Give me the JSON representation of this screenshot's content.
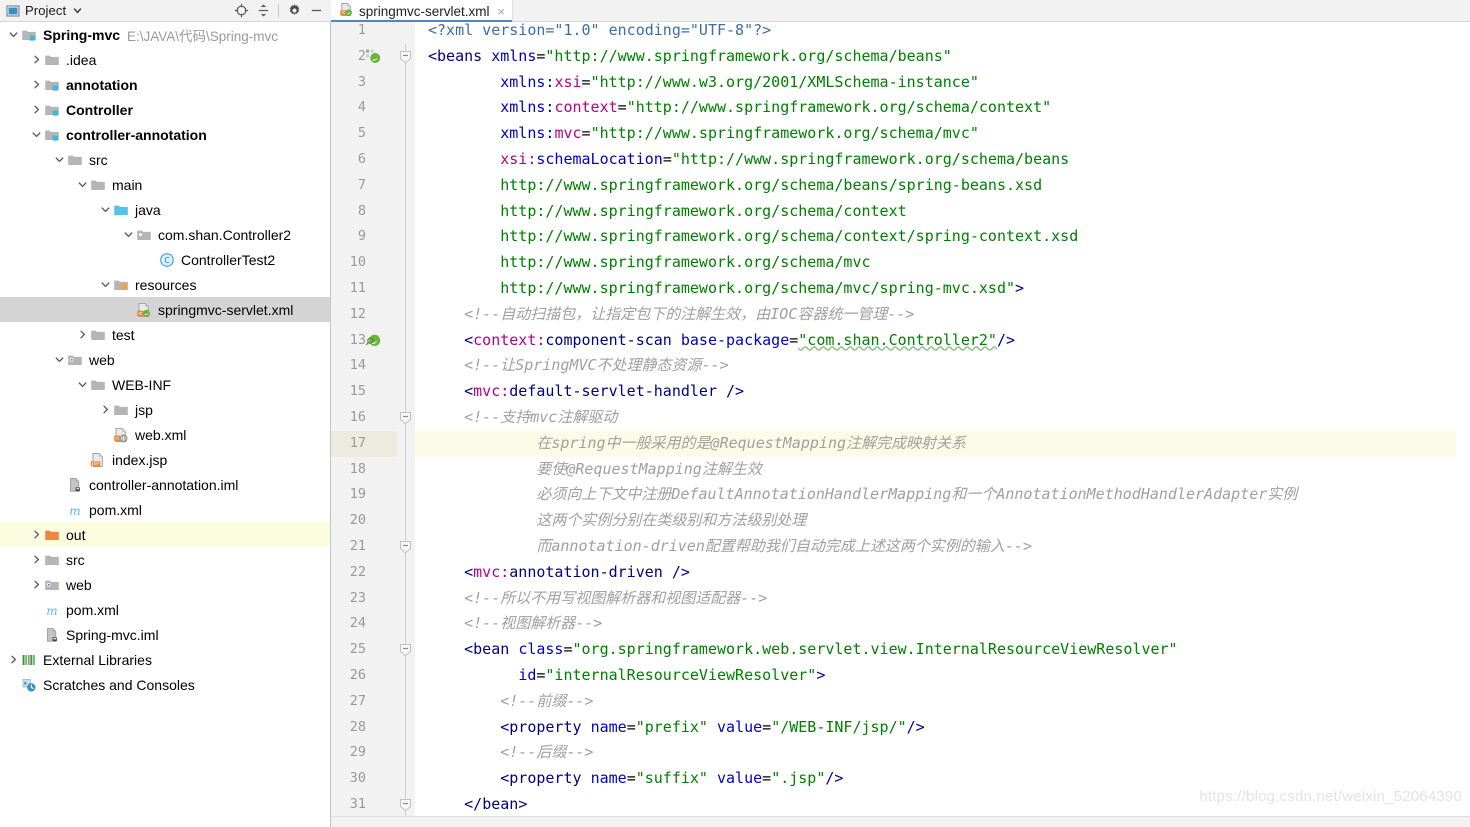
{
  "tool_window": {
    "title": "Project",
    "icons": [
      "project-view-icon",
      "chevron-down-icon",
      "locate-target-icon",
      "collapse-all-icon",
      "settings-gear-icon",
      "hide-window-icon"
    ]
  },
  "editor_tabs": [
    {
      "label": "springmvc-servlet.xml",
      "icon": "xml-spring-file-icon",
      "close": "×",
      "active": true
    }
  ],
  "project_tree": [
    {
      "indent": 0,
      "arrow": "down",
      "icon": "module-folder-icon",
      "label": "Spring-mvc",
      "bold": true,
      "path": "E:\\JAVA\\代码\\Spring-mvc",
      "state": "normal"
    },
    {
      "indent": 1,
      "arrow": "right",
      "icon": "folder-icon",
      "label": ".idea",
      "bold": false,
      "path": "",
      "state": "normal"
    },
    {
      "indent": 1,
      "arrow": "right",
      "icon": "module-folder-icon",
      "label": "annotation",
      "bold": true,
      "path": "",
      "state": "normal"
    },
    {
      "indent": 1,
      "arrow": "right",
      "icon": "module-folder-icon",
      "label": "Controller",
      "bold": true,
      "path": "",
      "state": "normal"
    },
    {
      "indent": 1,
      "arrow": "down",
      "icon": "module-folder-icon",
      "label": "controller-annotation",
      "bold": true,
      "path": "",
      "state": "normal"
    },
    {
      "indent": 2,
      "arrow": "down",
      "icon": "folder-icon",
      "label": "src",
      "bold": false,
      "path": "",
      "state": "normal"
    },
    {
      "indent": 3,
      "arrow": "down",
      "icon": "folder-icon",
      "label": "main",
      "bold": false,
      "path": "",
      "state": "normal"
    },
    {
      "indent": 4,
      "arrow": "down",
      "icon": "source-root-icon",
      "label": "java",
      "bold": false,
      "path": "",
      "state": "normal"
    },
    {
      "indent": 5,
      "arrow": "down",
      "icon": "package-icon",
      "label": "com.shan.Controller2",
      "bold": false,
      "path": "",
      "state": "normal"
    },
    {
      "indent": 6,
      "arrow": "none",
      "icon": "java-class-icon",
      "label": "ControllerTest2",
      "bold": false,
      "path": "",
      "state": "normal"
    },
    {
      "indent": 4,
      "arrow": "down",
      "icon": "resource-root-icon",
      "label": "resources",
      "bold": false,
      "path": "",
      "state": "normal"
    },
    {
      "indent": 5,
      "arrow": "none",
      "icon": "xml-spring-file-icon",
      "label": "springmvc-servlet.xml",
      "bold": false,
      "path": "",
      "state": "selected"
    },
    {
      "indent": 3,
      "arrow": "right",
      "icon": "folder-icon",
      "label": "test",
      "bold": false,
      "path": "",
      "state": "normal"
    },
    {
      "indent": 2,
      "arrow": "down",
      "icon": "web-root-icon",
      "label": "web",
      "bold": false,
      "path": "",
      "state": "normal"
    },
    {
      "indent": 3,
      "arrow": "down",
      "icon": "folder-icon",
      "label": "WEB-INF",
      "bold": false,
      "path": "",
      "state": "normal"
    },
    {
      "indent": 4,
      "arrow": "right",
      "icon": "folder-icon",
      "label": "jsp",
      "bold": false,
      "path": "",
      "state": "normal"
    },
    {
      "indent": 4,
      "arrow": "none",
      "icon": "xml-web-file-icon",
      "label": "web.xml",
      "bold": false,
      "path": "",
      "state": "normal"
    },
    {
      "indent": 3,
      "arrow": "none",
      "icon": "jsp-file-icon",
      "label": "index.jsp",
      "bold": false,
      "path": "",
      "state": "normal"
    },
    {
      "indent": 2,
      "arrow": "none",
      "icon": "iml-file-icon",
      "label": "controller-annotation.iml",
      "bold": false,
      "path": "",
      "state": "normal"
    },
    {
      "indent": 2,
      "arrow": "none",
      "icon": "maven-pom-icon",
      "label": "pom.xml",
      "bold": false,
      "path": "",
      "state": "normal"
    },
    {
      "indent": 1,
      "arrow": "right",
      "icon": "excluded-folder-icon",
      "label": "out",
      "bold": false,
      "path": "",
      "state": "highlight"
    },
    {
      "indent": 1,
      "arrow": "right",
      "icon": "folder-icon",
      "label": "src",
      "bold": false,
      "path": "",
      "state": "normal"
    },
    {
      "indent": 1,
      "arrow": "right",
      "icon": "web-root-icon",
      "label": "web",
      "bold": false,
      "path": "",
      "state": "normal"
    },
    {
      "indent": 1,
      "arrow": "none",
      "icon": "maven-pom-icon",
      "label": "pom.xml",
      "bold": false,
      "path": "",
      "state": "normal"
    },
    {
      "indent": 1,
      "arrow": "none",
      "icon": "iml-file-icon",
      "label": "Spring-mvc.iml",
      "bold": false,
      "path": "",
      "state": "normal"
    },
    {
      "indent": 0,
      "arrow": "right",
      "icon": "external-libraries-icon",
      "label": "External Libraries",
      "bold": false,
      "path": "",
      "state": "normal"
    },
    {
      "indent": 0,
      "arrow": "none",
      "icon": "scratches-icon",
      "label": "Scratches and Consoles",
      "bold": false,
      "path": "",
      "state": "normal"
    }
  ],
  "editor": {
    "file_name": "springmvc-servlet.xml",
    "current_line": 17,
    "first_visible_line": 1,
    "last_visible_line": 31,
    "gutter_icons": [
      {
        "line": 2,
        "icon": "spring-bean-gutter-icon"
      },
      {
        "line": 13,
        "icon": "spring-scan-gutter-icon"
      }
    ],
    "fold_markers": [
      2,
      16,
      21,
      25,
      31
    ],
    "lines": [
      {
        "n": 1,
        "indent": 0,
        "tokens": [
          {
            "c": "t-pi",
            "t": "<?xml version=\"1.0\" encoding=\"UTF-8\"?>"
          }
        ]
      },
      {
        "n": 2,
        "indent": 0,
        "tokens": [
          {
            "c": "t-br",
            "t": "<"
          },
          {
            "c": "t-tag",
            "t": "beans"
          },
          {
            "c": "t-eq",
            "t": " "
          },
          {
            "c": "t-attr",
            "t": "xmlns"
          },
          {
            "c": "t-eq",
            "t": "="
          },
          {
            "c": "t-str",
            "t": "\"http://www.springframework.org/schema/beans\""
          }
        ]
      },
      {
        "n": 3,
        "indent": 8,
        "tokens": [
          {
            "c": "t-attr",
            "t": "xmlns:"
          },
          {
            "c": "t-ns",
            "t": "xsi"
          },
          {
            "c": "t-eq",
            "t": "="
          },
          {
            "c": "t-str",
            "t": "\"http://www.w3.org/2001/XMLSchema-instance\""
          }
        ]
      },
      {
        "n": 4,
        "indent": 8,
        "tokens": [
          {
            "c": "t-attr",
            "t": "xmlns:"
          },
          {
            "c": "t-ns",
            "t": "context"
          },
          {
            "c": "t-eq",
            "t": "="
          },
          {
            "c": "t-str",
            "t": "\"http://www.springframework.org/schema/context\""
          }
        ]
      },
      {
        "n": 5,
        "indent": 8,
        "tokens": [
          {
            "c": "t-attr",
            "t": "xmlns:"
          },
          {
            "c": "t-ns",
            "t": "mvc"
          },
          {
            "c": "t-eq",
            "t": "="
          },
          {
            "c": "t-str",
            "t": "\"http://www.springframework.org/schema/mvc\""
          }
        ]
      },
      {
        "n": 6,
        "indent": 8,
        "tokens": [
          {
            "c": "t-ns",
            "t": "xsi:"
          },
          {
            "c": "t-attr",
            "t": "schemaLocation"
          },
          {
            "c": "t-eq",
            "t": "="
          },
          {
            "c": "t-str",
            "t": "\"http://www.springframework.org/schema/beans"
          }
        ]
      },
      {
        "n": 7,
        "indent": 8,
        "tokens": [
          {
            "c": "t-str",
            "t": "http://www.springframework.org/schema/beans/spring-beans.xsd"
          }
        ]
      },
      {
        "n": 8,
        "indent": 8,
        "tokens": [
          {
            "c": "t-str",
            "t": "http://www.springframework.org/schema/context"
          }
        ]
      },
      {
        "n": 9,
        "indent": 8,
        "tokens": [
          {
            "c": "t-str",
            "t": "http://www.springframework.org/schema/context/spring-context.xsd"
          }
        ]
      },
      {
        "n": 10,
        "indent": 8,
        "tokens": [
          {
            "c": "t-str",
            "t": "http://www.springframework.org/schema/mvc"
          }
        ]
      },
      {
        "n": 11,
        "indent": 8,
        "tokens": [
          {
            "c": "t-str",
            "t": "http://www.springframework.org/schema/mvc/spring-mvc.xsd\""
          },
          {
            "c": "t-br",
            "t": ">"
          }
        ]
      },
      {
        "n": 12,
        "indent": 4,
        "tokens": [
          {
            "c": "t-cmt",
            "t": "<!--自动扫描包，让指定包下的注解生效，由IOC容器统一管理-->"
          }
        ]
      },
      {
        "n": 13,
        "indent": 4,
        "tokens": [
          {
            "c": "t-br",
            "t": "<"
          },
          {
            "c": "t-ns",
            "t": "context:"
          },
          {
            "c": "t-tag",
            "t": "component-scan"
          },
          {
            "c": "t-eq",
            "t": " "
          },
          {
            "c": "t-attr",
            "t": "base-package"
          },
          {
            "c": "t-eq",
            "t": "="
          },
          {
            "c": "t-str squig",
            "t": "\"com.shan.Controller2\""
          },
          {
            "c": "t-br",
            "t": "/>"
          }
        ]
      },
      {
        "n": 14,
        "indent": 4,
        "tokens": [
          {
            "c": "t-cmt",
            "t": "<!--让SpringMVC不处理静态资源-->"
          }
        ]
      },
      {
        "n": 15,
        "indent": 4,
        "tokens": [
          {
            "c": "t-br",
            "t": "<"
          },
          {
            "c": "t-ns",
            "t": "mvc:"
          },
          {
            "c": "t-tag",
            "t": "default-servlet-handler"
          },
          {
            "c": "t-eq",
            "t": " "
          },
          {
            "c": "t-br",
            "t": "/>"
          }
        ]
      },
      {
        "n": 16,
        "indent": 4,
        "tokens": [
          {
            "c": "t-cmt",
            "t": "<!--支持mvc注解驱动"
          }
        ]
      },
      {
        "n": 17,
        "indent": 12,
        "tokens": [
          {
            "c": "t-cmt",
            "t": "在spring中一般采用的是@RequestMapping注解完成映射关系"
          }
        ]
      },
      {
        "n": 18,
        "indent": 12,
        "tokens": [
          {
            "c": "t-cmt",
            "t": "要使@RequestMapping注解生效"
          }
        ]
      },
      {
        "n": 19,
        "indent": 12,
        "tokens": [
          {
            "c": "t-cmt",
            "t": "必须向上下文中注册DefaultAnnotationHandlerMapping和一个AnnotationMethodHandlerAdapter实例"
          }
        ]
      },
      {
        "n": 20,
        "indent": 12,
        "tokens": [
          {
            "c": "t-cmt",
            "t": "这两个实例分别在类级别和方法级别处理"
          }
        ]
      },
      {
        "n": 21,
        "indent": 12,
        "tokens": [
          {
            "c": "t-cmt",
            "t": "而annotation-driven配置帮助我们自动完成上述这两个实例的输入-->"
          }
        ]
      },
      {
        "n": 22,
        "indent": 4,
        "tokens": [
          {
            "c": "t-br",
            "t": "<"
          },
          {
            "c": "t-ns",
            "t": "mvc:"
          },
          {
            "c": "t-tag",
            "t": "annotation-driven"
          },
          {
            "c": "t-eq",
            "t": " "
          },
          {
            "c": "t-br",
            "t": "/>"
          }
        ]
      },
      {
        "n": 23,
        "indent": 4,
        "tokens": [
          {
            "c": "t-cmt",
            "t": "<!--所以不用写视图解析器和视图适配器-->"
          }
        ]
      },
      {
        "n": 24,
        "indent": 4,
        "tokens": [
          {
            "c": "t-cmt",
            "t": "<!--视图解析器-->"
          }
        ]
      },
      {
        "n": 25,
        "indent": 4,
        "tokens": [
          {
            "c": "t-br",
            "t": "<"
          },
          {
            "c": "t-tag",
            "t": "bean"
          },
          {
            "c": "t-eq",
            "t": " "
          },
          {
            "c": "t-attr",
            "t": "class"
          },
          {
            "c": "t-eq",
            "t": "="
          },
          {
            "c": "t-str",
            "t": "\"org.springframework.web.servlet.view.InternalResourceViewResolver\""
          }
        ]
      },
      {
        "n": 26,
        "indent": 10,
        "tokens": [
          {
            "c": "t-attr",
            "t": "id"
          },
          {
            "c": "t-eq",
            "t": "="
          },
          {
            "c": "t-str",
            "t": "\"internalResourceViewResolver\""
          },
          {
            "c": "t-br",
            "t": ">"
          }
        ]
      },
      {
        "n": 27,
        "indent": 8,
        "tokens": [
          {
            "c": "t-cmt",
            "t": "<!--前缀-->"
          }
        ]
      },
      {
        "n": 28,
        "indent": 8,
        "tokens": [
          {
            "c": "t-br",
            "t": "<"
          },
          {
            "c": "t-tag",
            "t": "property"
          },
          {
            "c": "t-eq",
            "t": " "
          },
          {
            "c": "t-attr",
            "t": "name"
          },
          {
            "c": "t-eq",
            "t": "="
          },
          {
            "c": "t-str",
            "t": "\"prefix\""
          },
          {
            "c": "t-eq",
            "t": " "
          },
          {
            "c": "t-attr",
            "t": "value"
          },
          {
            "c": "t-eq",
            "t": "="
          },
          {
            "c": "t-str",
            "t": "\"/WEB-INF/jsp/\""
          },
          {
            "c": "t-br",
            "t": "/>"
          }
        ]
      },
      {
        "n": 29,
        "indent": 8,
        "tokens": [
          {
            "c": "t-cmt",
            "t": "<!--后缀-->"
          }
        ]
      },
      {
        "n": 30,
        "indent": 8,
        "tokens": [
          {
            "c": "t-br",
            "t": "<"
          },
          {
            "c": "t-tag",
            "t": "property"
          },
          {
            "c": "t-eq",
            "t": " "
          },
          {
            "c": "t-attr",
            "t": "name"
          },
          {
            "c": "t-eq",
            "t": "="
          },
          {
            "c": "t-str",
            "t": "\"suffix\""
          },
          {
            "c": "t-eq",
            "t": " "
          },
          {
            "c": "t-attr",
            "t": "value"
          },
          {
            "c": "t-eq",
            "t": "="
          },
          {
            "c": "t-str",
            "t": "\".jsp\""
          },
          {
            "c": "t-br",
            "t": "/>"
          }
        ]
      },
      {
        "n": 31,
        "indent": 4,
        "tokens": [
          {
            "c": "t-br",
            "t": "</"
          },
          {
            "c": "t-tag",
            "t": "bean"
          },
          {
            "c": "t-br",
            "t": ">"
          }
        ]
      }
    ]
  },
  "watermark": "https://blog.csdn.net/weixin_52064390",
  "colors": {
    "tree_selection": "#d4d4d4",
    "tree_highlight": "#fcfce0",
    "current_line": "#fcfbe8",
    "gutter_bg": "#f2f2f2",
    "tab_active_underline": "#4a86c8",
    "xml_tag": "#000080",
    "xml_namespace": "#b5008b",
    "xml_attr": "#0000c0",
    "xml_string": "#008000",
    "xml_comment": "#a0a0a0"
  }
}
